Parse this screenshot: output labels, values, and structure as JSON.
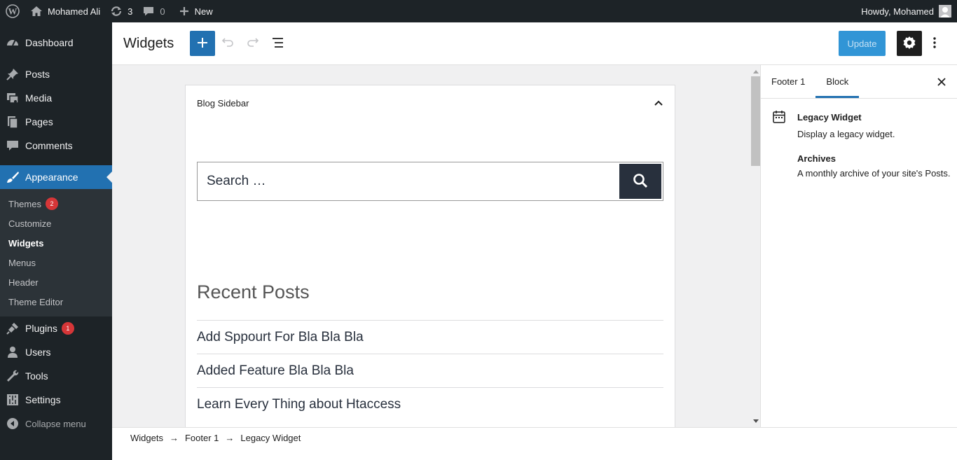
{
  "adminbar": {
    "site_name": "Mohamed Ali",
    "updates_count": "3",
    "comments_count": "0",
    "new_label": "New",
    "howdy": "Howdy, Mohamed"
  },
  "menu": {
    "dashboard": "Dashboard",
    "posts": "Posts",
    "media": "Media",
    "pages": "Pages",
    "comments": "Comments",
    "appearance": "Appearance",
    "sub": {
      "themes": "Themes",
      "themes_badge": "2",
      "customize": "Customize",
      "widgets": "Widgets",
      "menus": "Menus",
      "header": "Header",
      "theme_editor": "Theme Editor"
    },
    "plugins": "Plugins",
    "plugins_badge": "1",
    "users": "Users",
    "tools": "Tools",
    "settings": "Settings",
    "collapse": "Collapse menu"
  },
  "editor": {
    "title": "Widgets",
    "update_label": "Update"
  },
  "canvas": {
    "area_title": "Blog Sidebar",
    "search_placeholder": "Search …",
    "recent_posts_title": "Recent Posts",
    "recent_posts": [
      "Add Sppourt For Bla Bla Bla",
      "Added Feature Bla Bla Bla",
      "Learn Every Thing about Htaccess"
    ]
  },
  "inspector": {
    "tab_area": "Footer 1",
    "tab_block": "Block",
    "block_title": "Legacy Widget",
    "block_desc": "Display a legacy widget.",
    "widget_name": "Archives",
    "widget_desc": "A monthly archive of your site's Posts."
  },
  "breadcrumb": {
    "items": [
      "Widgets",
      "Footer 1",
      "Legacy Widget"
    ],
    "separator": "→"
  }
}
